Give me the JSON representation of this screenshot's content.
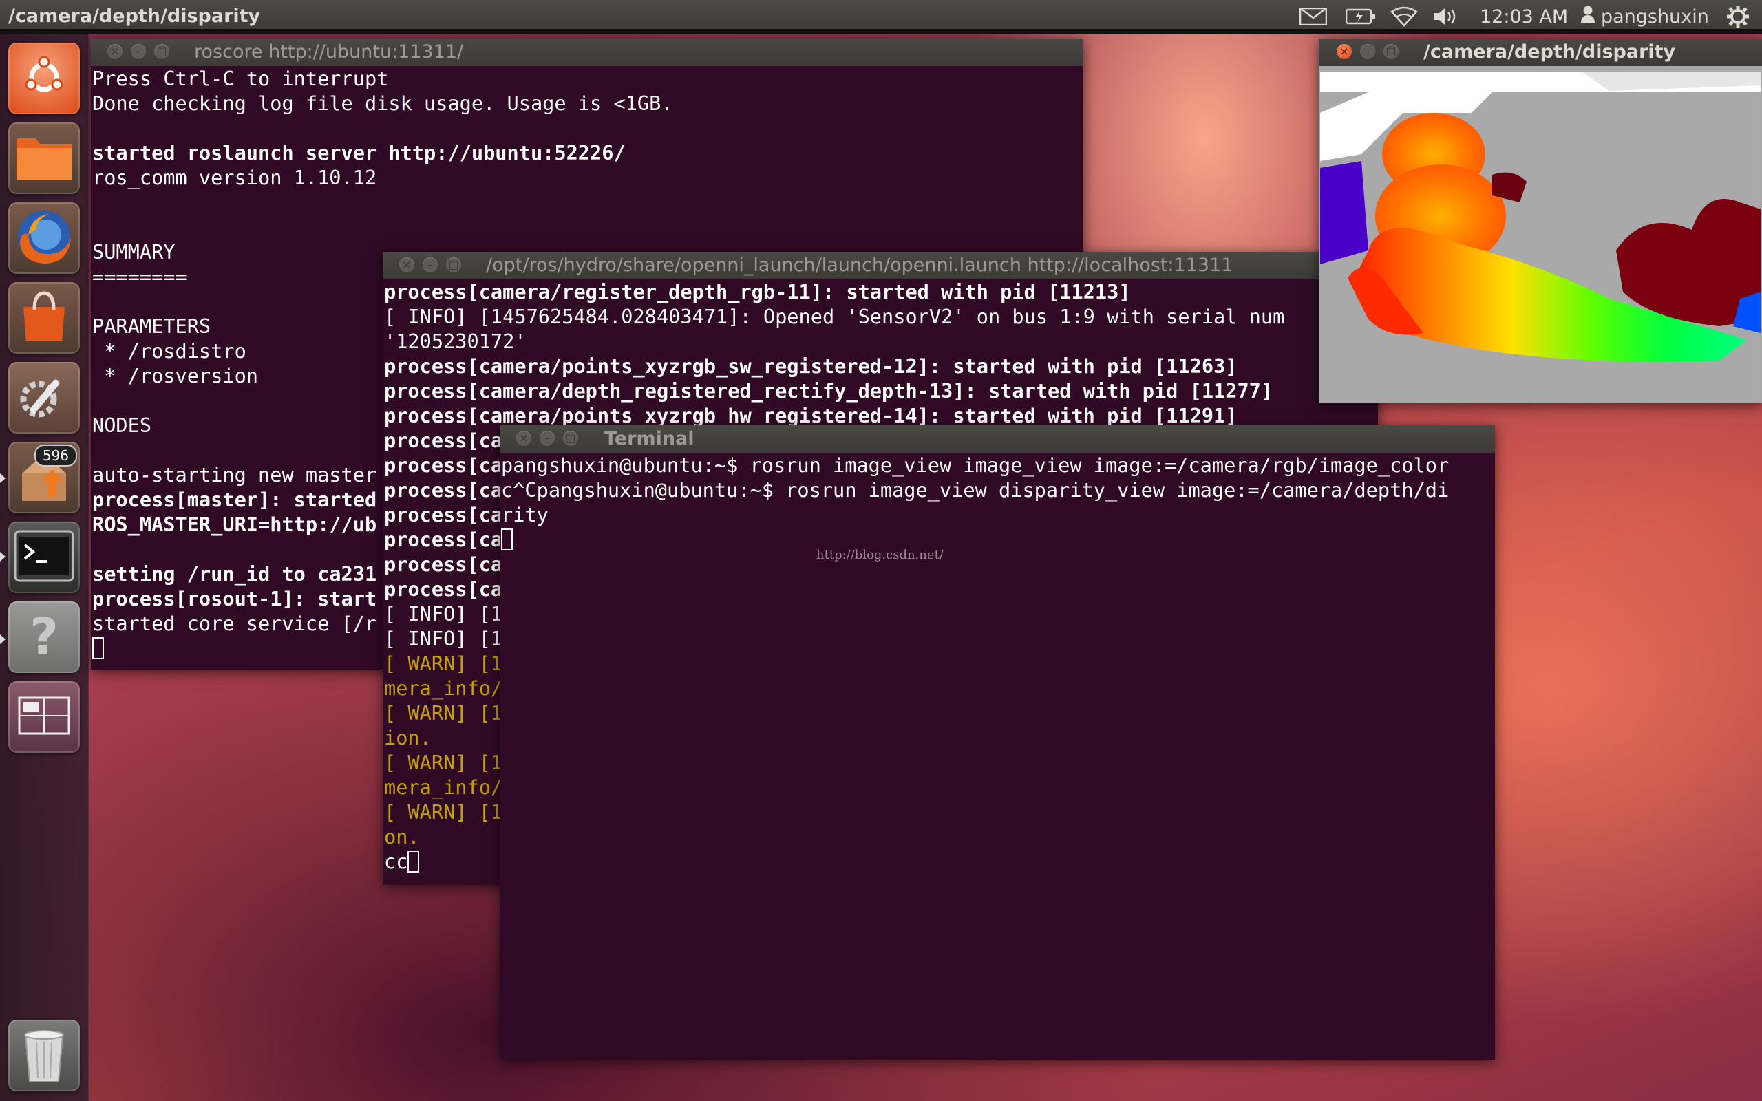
{
  "top_panel": {
    "window_title": "/camera/depth/disparity",
    "time": "12:03 AM",
    "user": "pangshuxin",
    "indicators": [
      "mail-icon",
      "battery-icon",
      "wifi-icon",
      "volume-icon",
      "user-icon",
      "gear-icon"
    ]
  },
  "launcher": {
    "items": [
      {
        "name": "dash-button",
        "icon": "ubuntu-logo-icon"
      },
      {
        "name": "files-button",
        "icon": "folder-icon"
      },
      {
        "name": "firefox-button",
        "icon": "firefox-icon"
      },
      {
        "name": "software-center-button",
        "icon": "shopping-bag-icon"
      },
      {
        "name": "system-settings-button",
        "icon": "settings-wrench-icon"
      },
      {
        "name": "update-manager-button",
        "icon": "update-box-icon",
        "badge": "596"
      },
      {
        "name": "terminal-button",
        "icon": "terminal-icon"
      },
      {
        "name": "help-button",
        "icon": "question-icon"
      },
      {
        "name": "workspace-switcher-button",
        "icon": "workspace-icon"
      },
      {
        "name": "trash-button",
        "icon": "trash-icon"
      }
    ]
  },
  "windows": {
    "roscore": {
      "title": "roscore http://ubuntu:11311/",
      "lines": [
        {
          "text": "Press Ctrl-C to interrupt",
          "style": ""
        },
        {
          "text": "Done checking log file disk usage. Usage is <1GB.",
          "style": ""
        },
        {
          "text": "",
          "style": ""
        },
        {
          "text": "started roslaunch server http://ubuntu:52226/",
          "style": "b"
        },
        {
          "text": "ros_comm version 1.10.12",
          "style": ""
        },
        {
          "text": "",
          "style": ""
        },
        {
          "text": "",
          "style": ""
        },
        {
          "text": "SUMMARY",
          "style": ""
        },
        {
          "text": "========",
          "style": ""
        },
        {
          "text": "",
          "style": ""
        },
        {
          "text": "PARAMETERS",
          "style": ""
        },
        {
          "text": " * /rosdistro",
          "style": ""
        },
        {
          "text": " * /rosversion",
          "style": ""
        },
        {
          "text": "",
          "style": ""
        },
        {
          "text": "NODES",
          "style": ""
        },
        {
          "text": "",
          "style": ""
        },
        {
          "text": "auto-starting new master",
          "style": ""
        },
        {
          "text": "process[master]: started",
          "style": "b"
        },
        {
          "text": "ROS_MASTER_URI=http://ub",
          "style": "b"
        },
        {
          "text": "",
          "style": ""
        },
        {
          "text": "setting /run_id to ca231",
          "style": "b"
        },
        {
          "text": "process[rosout-1]: start",
          "style": "b"
        },
        {
          "text": "started core service [/r",
          "style": ""
        }
      ]
    },
    "openni": {
      "title": "/opt/ros/hydro/share/openni_launch/launch/openni.launch http://localhost:11311",
      "lines": [
        {
          "text": "process[camera/register_depth_rgb-11]: started with pid [11213]",
          "style": "b"
        },
        {
          "text": "[ INFO] [1457625484.028403471]: Opened 'SensorV2' on bus 1:9 with serial num",
          "style": ""
        },
        {
          "text": "'1205230172'",
          "style": ""
        },
        {
          "text": "process[camera/points_xyzrgb_sw_registered-12]: started with pid [11263]",
          "style": "b"
        },
        {
          "text": "process[camera/depth_registered_rectify_depth-13]: started with pid [11277]",
          "style": "b"
        },
        {
          "text": "process[camera/points_xyzrgb_hw_registered-14]: started with pid [11291]",
          "style": "b"
        },
        {
          "text": "process[ca",
          "style": "b"
        },
        {
          "text": "process[ca",
          "style": "b"
        },
        {
          "text": "process[ca",
          "style": "b"
        },
        {
          "text": "process[ca",
          "style": "b"
        },
        {
          "text": "process[ca",
          "style": "b"
        },
        {
          "text": "process[ca",
          "style": "b"
        },
        {
          "text": "process[ca",
          "style": "b"
        },
        {
          "text": "[ INFO] [1",
          "style": ""
        },
        {
          "text": "[ INFO] [1",
          "style": ""
        },
        {
          "text": "[ WARN] [1",
          "style": "warn"
        },
        {
          "text": "mera_info/",
          "style": "warn"
        },
        {
          "text": "[ WARN] [1",
          "style": "warn"
        },
        {
          "text": "ion.",
          "style": "warn"
        },
        {
          "text": "[ WARN] [1",
          "style": "warn"
        },
        {
          "text": "mera_info/",
          "style": "warn"
        },
        {
          "text": "[ WARN] [1",
          "style": "warn"
        },
        {
          "text": "on.",
          "style": "warn"
        },
        {
          "text": "cc",
          "style": ""
        }
      ]
    },
    "terminal": {
      "title": "Terminal",
      "lines": [
        {
          "text": "pangshuxin@ubuntu:~$ rosrun image_view image_view image:=/camera/rgb/image_color",
          "style": ""
        },
        {
          "text": "c^Cpangshuxin@ubuntu:~$ rosrun image_view disparity_view image:=/camera/depth/di",
          "style": ""
        },
        {
          "text": "rity",
          "style": ""
        }
      ],
      "watermark": "http://blog.csdn.net/"
    },
    "disparity": {
      "title": "/camera/depth/disparity"
    }
  },
  "colors": {
    "terminal_bg": "#300a24",
    "panel_bg": "#3c3b37",
    "warn": "#c4a000",
    "close_button": "#e55b2b"
  }
}
